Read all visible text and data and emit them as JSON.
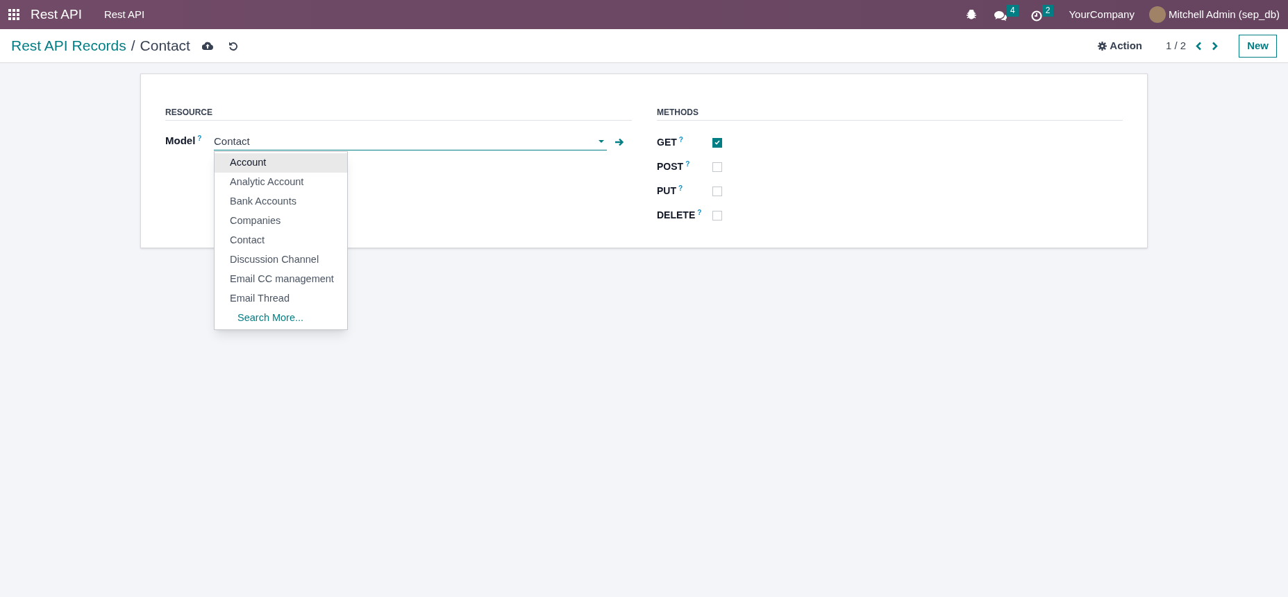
{
  "navbar": {
    "app_name": "Rest API",
    "menu": [
      "Rest API"
    ],
    "messages_count": "4",
    "activities_count": "2",
    "company": "YourCompany",
    "user": "Mitchell Admin (sep_db)"
  },
  "control_panel": {
    "breadcrumb_parent": "Rest API Records",
    "breadcrumb_separator": "/",
    "breadcrumb_current": "Contact",
    "action": "Action",
    "pager": "1 / 2",
    "new_button": "New"
  },
  "resource": {
    "heading": "RESOURCE",
    "field_label": "Model",
    "help_mark": "?",
    "value": "Contact",
    "dropdown": [
      {
        "label": "Account",
        "highlighted": true
      },
      {
        "label": "Analytic Account",
        "highlighted": false
      },
      {
        "label": "Bank Accounts",
        "highlighted": false
      },
      {
        "label": "Companies",
        "highlighted": false
      },
      {
        "label": "Contact",
        "highlighted": false
      },
      {
        "label": "Discussion Channel",
        "highlighted": false
      },
      {
        "label": "Email CC management",
        "highlighted": false
      },
      {
        "label": "Email Thread",
        "highlighted": false
      }
    ],
    "search_more": "Search More..."
  },
  "methods": {
    "heading": "METHODS",
    "items": [
      {
        "label": "GET",
        "help_mark": "?",
        "checked": true
      },
      {
        "label": "POST",
        "help_mark": "?",
        "checked": false
      },
      {
        "label": "PUT",
        "help_mark": "?",
        "checked": false
      },
      {
        "label": "DELETE",
        "help_mark": "?",
        "checked": false
      }
    ]
  }
}
